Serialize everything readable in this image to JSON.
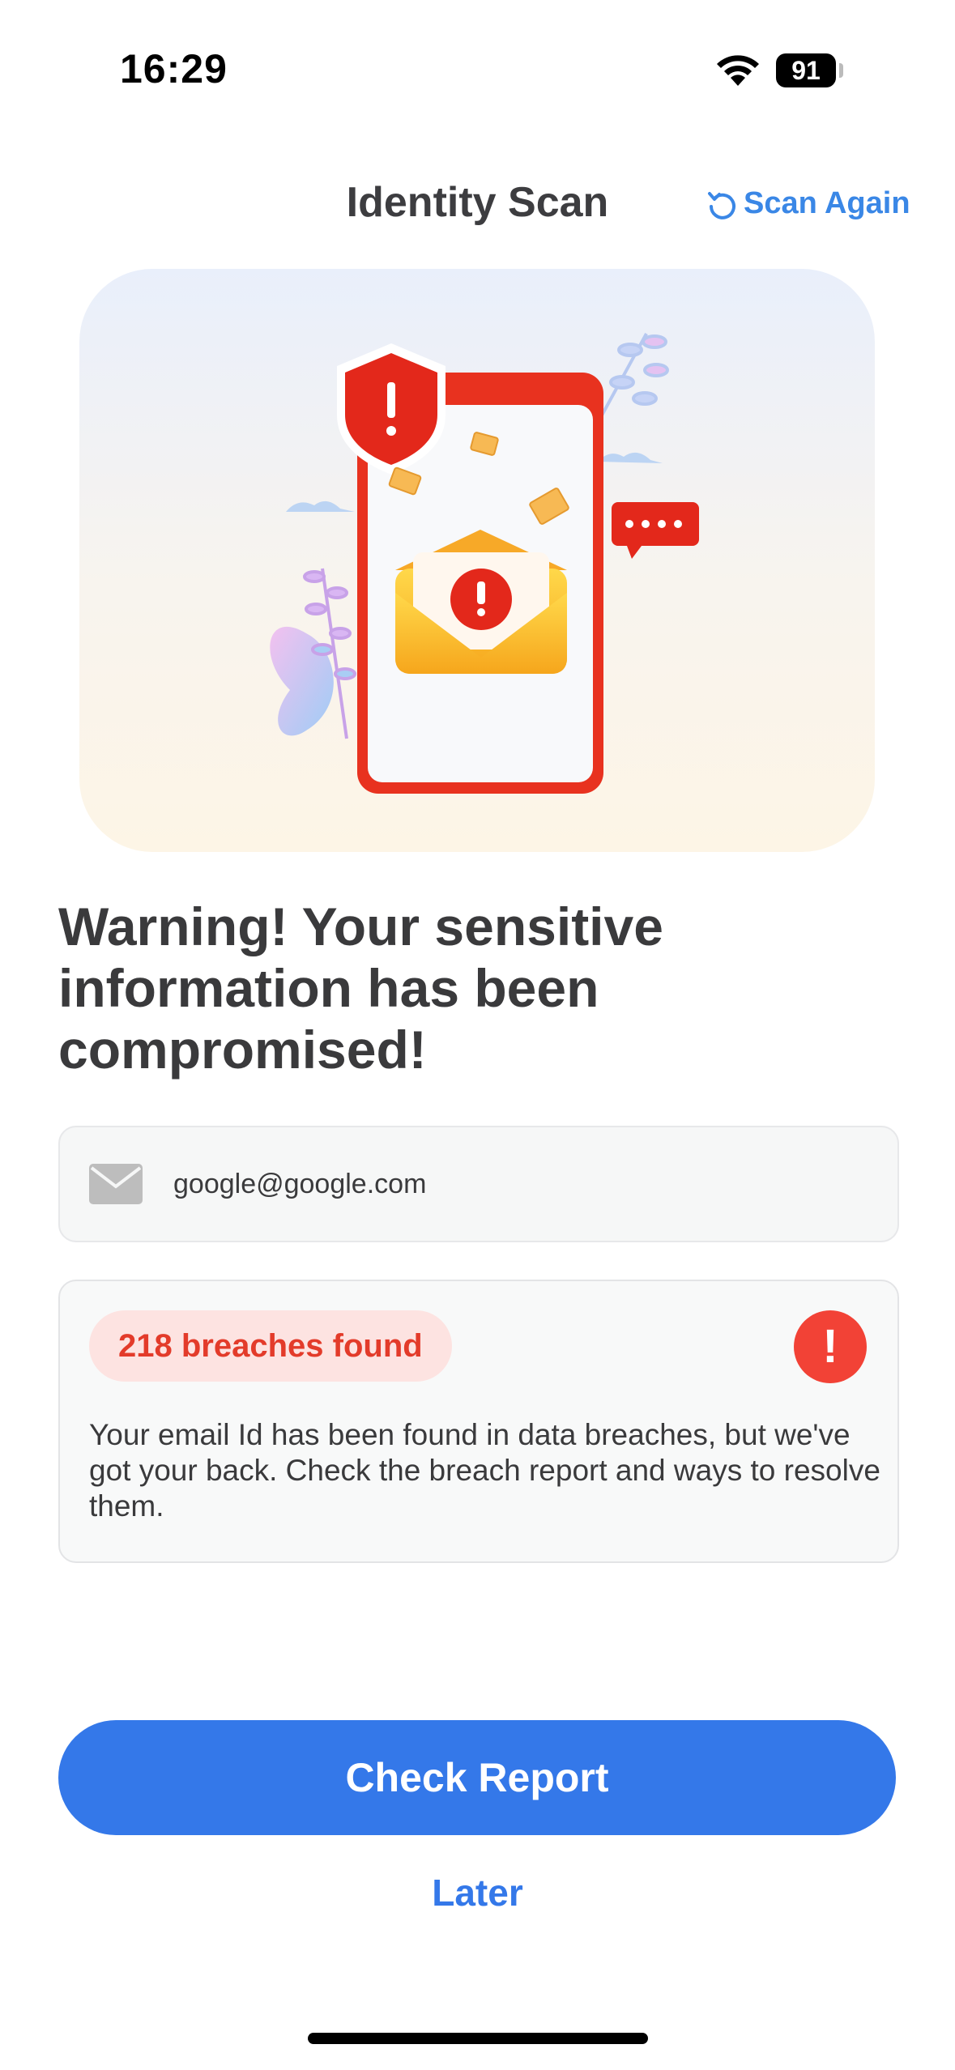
{
  "status_bar": {
    "time": "16:29",
    "battery": "91"
  },
  "header": {
    "title": "Identity Scan",
    "scan_again_label": "Scan Again"
  },
  "headline": "Warning! Your sensitive information has been compromised!",
  "email_card": {
    "email": "google@google.com"
  },
  "breach_card": {
    "badge": "218 breaches found",
    "alert_glyph": "!",
    "description": "Your email Id has been found in data breaches, but we've got your back. Check the breach report and ways to resolve them."
  },
  "actions": {
    "primary_label": "Check Report",
    "secondary_label": "Later"
  },
  "colors": {
    "accent": "#3478e9",
    "danger": "#f24236",
    "danger_bg": "#fde3e1"
  }
}
